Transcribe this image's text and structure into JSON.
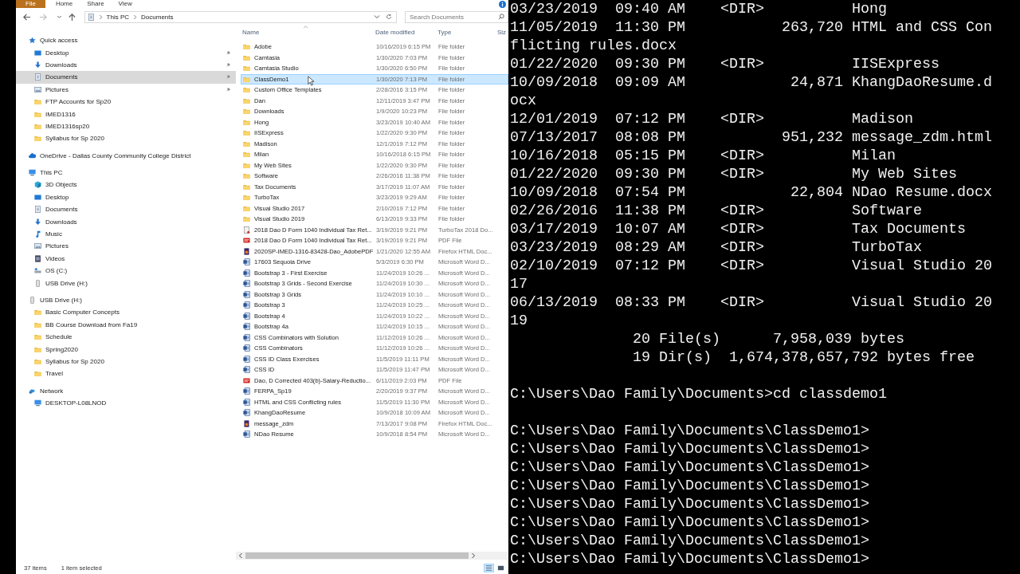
{
  "ribbon": {
    "tabs": [
      {
        "label": "File",
        "kind": "file"
      },
      {
        "label": "Home",
        "kind": "tab"
      },
      {
        "label": "Share",
        "kind": "tab"
      },
      {
        "label": "View",
        "kind": "tab"
      }
    ]
  },
  "address": {
    "crumbs": [
      "This PC",
      "Documents"
    ],
    "search": {
      "placeholder": "Search Documents"
    }
  },
  "nav": [
    {
      "label": "Quick access",
      "kind": "star",
      "selected": false,
      "items": [
        {
          "label": "Desktop",
          "kind": "desktop",
          "pinned": true,
          "selected": false
        },
        {
          "label": "Downloads",
          "kind": "downloads",
          "pinned": true,
          "selected": false
        },
        {
          "label": "Documents",
          "kind": "documents",
          "pinned": true,
          "selected": true
        },
        {
          "label": "Pictures",
          "kind": "pictures",
          "pinned": true,
          "selected": false
        },
        {
          "label": "FTP Accounts for Sp20",
          "kind": "folder",
          "pinned": false,
          "selected": false
        },
        {
          "label": "IMED1316",
          "kind": "folder",
          "pinned": false,
          "selected": false
        },
        {
          "label": "IMED1316sp20",
          "kind": "folder",
          "pinned": false,
          "selected": false
        },
        {
          "label": "Syllabus for Sp 2020",
          "kind": "folder",
          "pinned": false,
          "selected": false
        }
      ]
    },
    {
      "label": "OneDrive - Dallas County Community College District",
      "kind": "cloud",
      "selected": false
    },
    {
      "label": "This PC",
      "kind": "computer",
      "selected": false,
      "items": [
        {
          "label": "3D Objects",
          "kind": "cube",
          "selected": false
        },
        {
          "label": "Desktop",
          "kind": "desktop",
          "selected": false
        },
        {
          "label": "Documents",
          "kind": "documents",
          "selected": false
        },
        {
          "label": "Downloads",
          "kind": "downloads",
          "selected": false
        },
        {
          "label": "Music",
          "kind": "music",
          "selected": false
        },
        {
          "label": "Pictures",
          "kind": "pictures",
          "selected": false
        },
        {
          "label": "Videos",
          "kind": "videos",
          "selected": false
        },
        {
          "label": "OS (C:)",
          "kind": "drive",
          "selected": false
        },
        {
          "label": "USB Drive (H:)",
          "kind": "usb",
          "selected": false
        }
      ]
    },
    {
      "label": "USB Drive (H:)",
      "kind": "usb",
      "selected": false,
      "items": [
        {
          "label": "Basic Computer Concepts",
          "kind": "folder",
          "selected": false
        },
        {
          "label": "BB Course Download from Fa19",
          "kind": "folder",
          "selected": false
        },
        {
          "label": "Schedule",
          "kind": "folder",
          "selected": false
        },
        {
          "label": "Spring2020",
          "kind": "folder",
          "selected": false
        },
        {
          "label": "Syllabus for Sp 2020",
          "kind": "folder",
          "selected": false
        },
        {
          "label": "Travel",
          "kind": "folder",
          "selected": false
        }
      ]
    },
    {
      "label": "Network",
      "kind": "network",
      "selected": false,
      "items": [
        {
          "label": "DESKTOP-L08LNOD",
          "kind": "computer",
          "selected": false
        }
      ]
    }
  ],
  "files": {
    "columns": [
      "Name",
      "Date modified",
      "Type",
      "Siz"
    ],
    "rows": [
      {
        "name": "Adobe",
        "date": "10/16/2019 6:15 PM",
        "type": "File folder",
        "kind": "folder",
        "selected": false
      },
      {
        "name": "Camtasia",
        "date": "1/30/2020 7:03 PM",
        "type": "File folder",
        "kind": "folder",
        "selected": false
      },
      {
        "name": "Camtasia Studio",
        "date": "1/30/2020 6:50 PM",
        "type": "File folder",
        "kind": "folder",
        "selected": false
      },
      {
        "name": "ClassDemo1",
        "date": "1/30/2020 7:13 PM",
        "type": "File folder",
        "kind": "folder",
        "selected": true
      },
      {
        "name": "Custom Office Templates",
        "date": "2/28/2016 3:15 PM",
        "type": "File folder",
        "kind": "folder",
        "selected": false
      },
      {
        "name": "Dan",
        "date": "12/11/2019 3:47 PM",
        "type": "File folder",
        "kind": "folder",
        "selected": false
      },
      {
        "name": "Downloads",
        "date": "1/9/2020 10:23 PM",
        "type": "File folder",
        "kind": "folder",
        "selected": false
      },
      {
        "name": "Hong",
        "date": "3/23/2019 10:40 AM",
        "type": "File folder",
        "kind": "folder",
        "selected": false
      },
      {
        "name": "IISExpress",
        "date": "1/22/2020 9:30 PM",
        "type": "File folder",
        "kind": "folder",
        "selected": false
      },
      {
        "name": "Madison",
        "date": "12/1/2019 7:12 PM",
        "type": "File folder",
        "kind": "folder",
        "selected": false
      },
      {
        "name": "Milan",
        "date": "10/16/2018 6:15 PM",
        "type": "File folder",
        "kind": "folder",
        "selected": false
      },
      {
        "name": "My Web Sites",
        "date": "1/22/2020 9:30 PM",
        "type": "File folder",
        "kind": "folder",
        "selected": false
      },
      {
        "name": "Software",
        "date": "2/26/2016 11:38 PM",
        "type": "File folder",
        "kind": "folder",
        "selected": false
      },
      {
        "name": "Tax Documents",
        "date": "3/17/2019 11:07 AM",
        "type": "File folder",
        "kind": "folder",
        "selected": false
      },
      {
        "name": "TurboTax",
        "date": "3/23/2019 9:29 AM",
        "type": "File folder",
        "kind": "folder",
        "selected": false
      },
      {
        "name": "Visual Studio 2017",
        "date": "2/10/2019 7:12 PM",
        "type": "File folder",
        "kind": "folder",
        "selected": false
      },
      {
        "name": "Visual Studio 2019",
        "date": "6/13/2019 9:33 PM",
        "type": "File folder",
        "kind": "folder",
        "selected": false
      },
      {
        "name": "2018 Dao D Form 1040  Individual Tax Ret...",
        "date": "3/19/2019 9:21 PM",
        "type": "TurboTax 2018 Do...",
        "kind": "tax",
        "selected": false
      },
      {
        "name": "2018 Dao D Form 1040  Individual Tax Ret...",
        "date": "3/19/2019 9:21 PM",
        "type": "PDF File",
        "kind": "pdf",
        "selected": false
      },
      {
        "name": "2020SP-IMED-1316-83428-Dao_AdobePDF",
        "date": "1/21/2020 12:55 AM",
        "type": "Firefox HTML Doc...",
        "kind": "html",
        "selected": false
      },
      {
        "name": "17603 Sequoia Drive",
        "date": "5/3/2019 6:30 PM",
        "type": "Microsoft Word D...",
        "kind": "word",
        "selected": false
      },
      {
        "name": "Bootstrap 3 -  First Exercise",
        "date": "11/24/2019 10:26 ...",
        "type": "Microsoft Word D...",
        "kind": "word",
        "selected": false
      },
      {
        "name": "Bootstrap 3 Grids - Second Exercise",
        "date": "11/24/2019 10:30 ...",
        "type": "Microsoft Word D...",
        "kind": "word",
        "selected": false
      },
      {
        "name": "Bootstrap 3 Grids",
        "date": "11/24/2019 10:10 ...",
        "type": "Microsoft Word D...",
        "kind": "word",
        "selected": false
      },
      {
        "name": "Bootstrap 3",
        "date": "11/24/2019 10:25 ...",
        "type": "Microsoft Word D...",
        "kind": "word",
        "selected": false
      },
      {
        "name": "Bootstrap 4",
        "date": "11/24/2019 10:22 ...",
        "type": "Microsoft Word D...",
        "kind": "word",
        "selected": false
      },
      {
        "name": "Bootstrap 4a",
        "date": "11/24/2019 10:15 ...",
        "type": "Microsoft Word D...",
        "kind": "word",
        "selected": false
      },
      {
        "name": "CSS Combinators with Solution",
        "date": "11/12/2019 10:26 ...",
        "type": "Microsoft Word D...",
        "kind": "word",
        "selected": false
      },
      {
        "name": "CSS Combinators",
        "date": "11/12/2019 10:26 ...",
        "type": "Microsoft Word D...",
        "kind": "word",
        "selected": false
      },
      {
        "name": "CSS ID Class Exercises",
        "date": "11/5/2019 11:11 PM",
        "type": "Microsoft Word D...",
        "kind": "word",
        "selected": false
      },
      {
        "name": "CSS ID",
        "date": "11/5/2019 11:47 PM",
        "type": "Microsoft Word D...",
        "kind": "word",
        "selected": false
      },
      {
        "name": "Dao, D Corrected 403(b)-Salary-Reductio...",
        "date": "6/11/2019 2:03 PM",
        "type": "PDF File",
        "kind": "pdf",
        "selected": false
      },
      {
        "name": "FERPA_Sp19",
        "date": "2/20/2019 9:37 PM",
        "type": "Microsoft Word D...",
        "kind": "word",
        "selected": false
      },
      {
        "name": "HTML and CSS Conflicting rules",
        "date": "11/5/2019 11:30 PM",
        "type": "Microsoft Word D...",
        "kind": "word",
        "selected": false
      },
      {
        "name": "KhangDaoResume",
        "date": "10/9/2018 10:09 AM",
        "type": "Microsoft Word D...",
        "kind": "word",
        "selected": false
      },
      {
        "name": "message_zdm",
        "date": "7/13/2017 9:08 PM",
        "type": "Firefox HTML Doc...",
        "kind": "html",
        "selected": false
      },
      {
        "name": "NDao Resume",
        "date": "10/9/2018 8:54 PM",
        "type": "Microsoft Word D...",
        "kind": "word",
        "selected": false
      }
    ]
  },
  "status_bar": {
    "count": "37 items",
    "selection": "1 item selected",
    "views": [
      {
        "kind": "details",
        "selected": true
      },
      {
        "kind": "tiles",
        "selected": false
      }
    ]
  },
  "terminal": {
    "blocks": [
      [
        "03/23/2019  09:40 AM    <DIR>          Hong",
        "11/05/2019  11:30 PM           263,720 HTML and CSS Con",
        "flicting rules.docx",
        "01/22/2020  09:30 PM    <DIR>          IISExpress",
        "10/09/2018  09:09 AM            24,871 KhangDaoResume.d",
        "ocx",
        "12/01/2019  07:12 PM    <DIR>          Madison",
        "07/13/2017  08:08 PM           951,232 message_zdm.html",
        "10/16/2018  05:15 PM    <DIR>          Milan",
        "01/22/2020  09:30 PM    <DIR>          My Web Sites",
        "10/09/2018  07:54 PM            22,804 NDao Resume.docx",
        "02/26/2016  11:38 PM    <DIR>          Software",
        "03/17/2019  10:07 AM    <DIR>          Tax Documents",
        "03/23/2019  08:29 AM    <DIR>          TurboTax",
        "02/10/2019  07:12 PM    <DIR>          Visual Studio 20",
        "17",
        "06/13/2019  08:33 PM    <DIR>          Visual Studio 20",
        "19",
        "              20 File(s)      7,958,039 bytes",
        "              19 Dir(s)  1,674,378,657,792 bytes free"
      ],
      [
        "C:\\Users\\Dao Family\\Documents>cd classdemo1"
      ],
      [
        "C:\\Users\\Dao Family\\Documents\\ClassDemo1>",
        "C:\\Users\\Dao Family\\Documents\\ClassDemo1>",
        "C:\\Users\\Dao Family\\Documents\\ClassDemo1>",
        "C:\\Users\\Dao Family\\Documents\\ClassDemo1>",
        "C:\\Users\\Dao Family\\Documents\\ClassDemo1>",
        "C:\\Users\\Dao Family\\Documents\\ClassDemo1>",
        "C:\\Users\\Dao Family\\Documents\\ClassDemo1>",
        "C:\\Users\\Dao Family\\Documents\\ClassDemo1>"
      ]
    ]
  }
}
